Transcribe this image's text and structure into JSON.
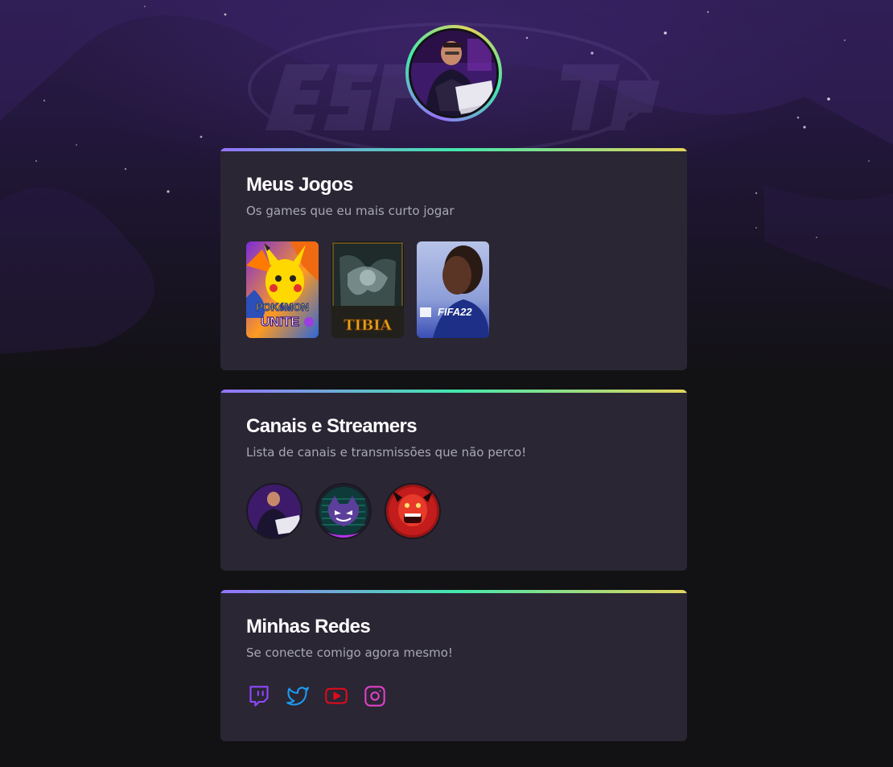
{
  "profile": {
    "avatar_alt": "Profile photo"
  },
  "sections": {
    "games": {
      "title": "Meus Jogos",
      "subtitle": "Os games que eu mais curto jogar",
      "items": [
        {
          "name": "Pokémon Unite",
          "logo_line1": "POKéMON",
          "logo_line2": "UNITE"
        },
        {
          "name": "Tibia",
          "logo": "TIBIA"
        },
        {
          "name": "FIFA 22",
          "logo": "FIFA22"
        }
      ]
    },
    "channels": {
      "title": "Canais e Streamers",
      "subtitle": "Lista de canais e transmissões que não perco!",
      "items": [
        {
          "name": "channel-1"
        },
        {
          "name": "channel-2"
        },
        {
          "name": "channel-3"
        }
      ]
    },
    "social": {
      "title": "Minhas Redes",
      "subtitle": "Se conecte comigo agora mesmo!",
      "items": [
        {
          "icon": "twitch-icon",
          "color": "#9146ff"
        },
        {
          "icon": "twitter-icon",
          "color": "#1d9bf0"
        },
        {
          "icon": "youtube-icon",
          "color": "#e00b1c"
        },
        {
          "icon": "instagram-icon",
          "color": "#e040c8"
        }
      ]
    }
  },
  "colors": {
    "background": "#121214",
    "card": "#2a2634",
    "accent_gradient": [
      "#9572fc",
      "#43e7ad",
      "#e2d45c"
    ]
  }
}
